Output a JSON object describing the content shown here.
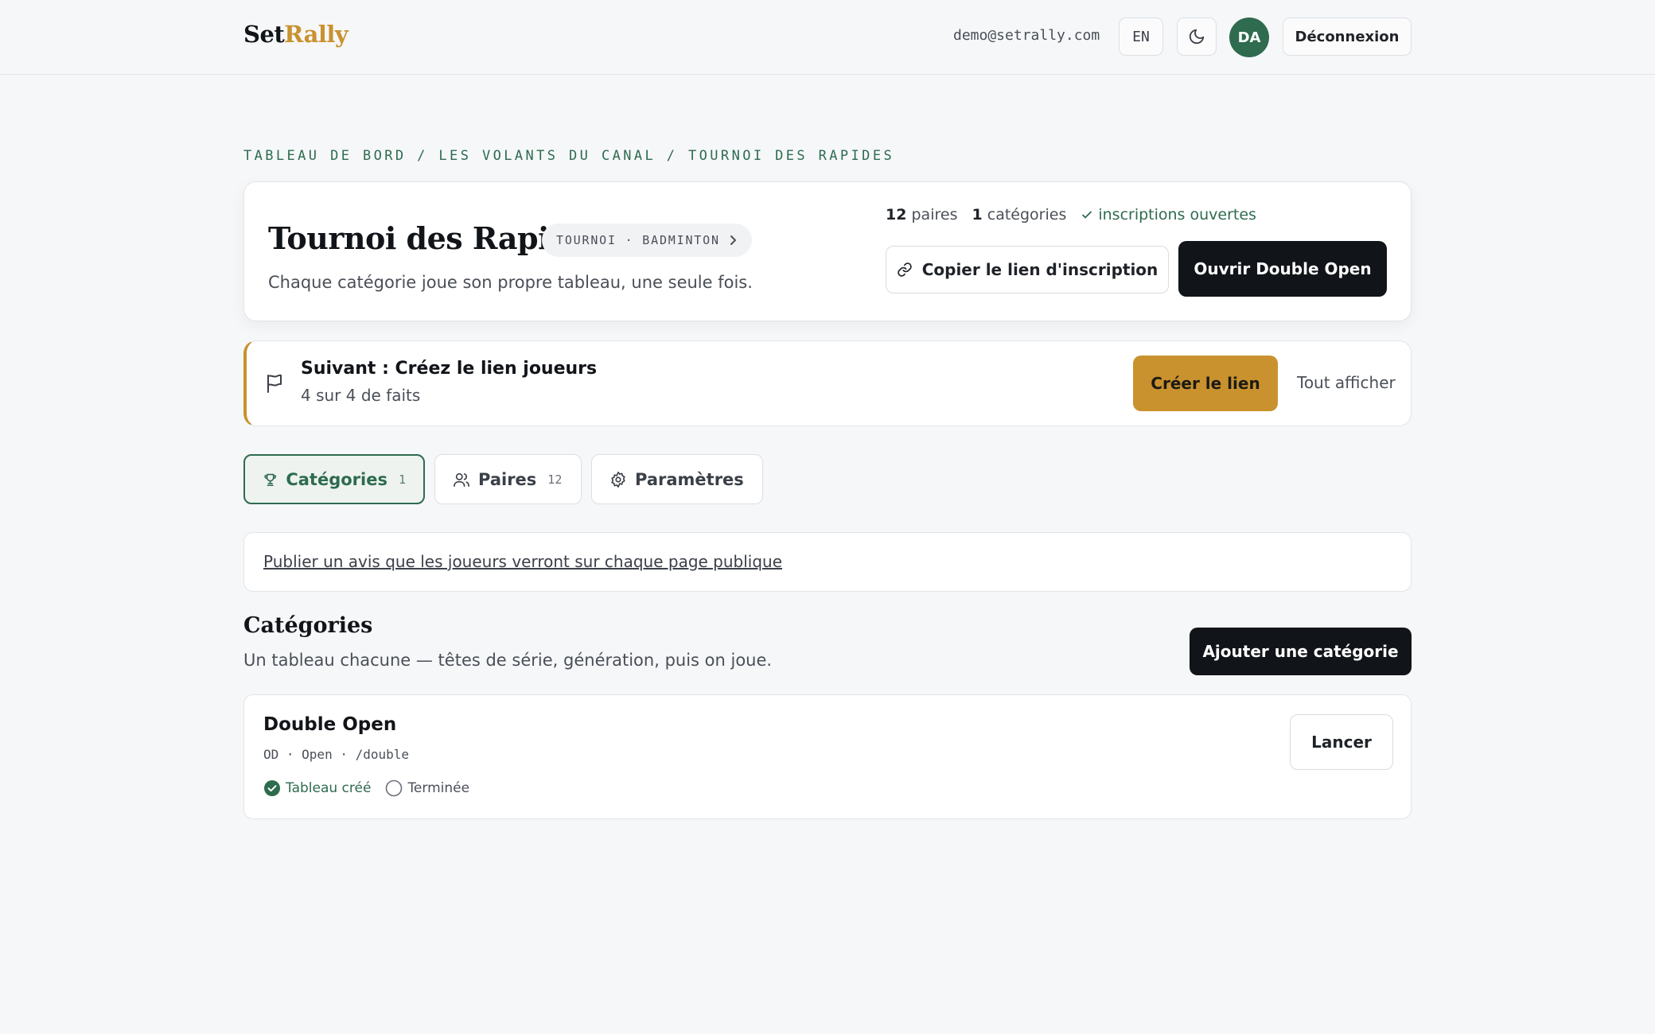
{
  "nav": {
    "logo_part1": "Set",
    "logo_part2": "Rally",
    "email": "demo@setrally.com",
    "lang": "EN",
    "avatar": "DA",
    "logout": "Déconnexion"
  },
  "breadcrumb": "TABLEAU DE BORD / LES VOLANTS DU CANAL / TOURNOI DES RAPIDES",
  "tournament": {
    "title": "Tournoi des Rapides",
    "pill": "TOURNOI · BADMINTON",
    "subtitle": "Chaque catégorie joue son propre tableau, une seule fois.",
    "pairs_count": "12",
    "pairs_label": "paires",
    "categories_count": "1",
    "categories_label": "catégories",
    "registration_status": "inscriptions ouvertes",
    "copy_link": "Copier le lien d'inscription",
    "open_button": "Ouvrir Double Open"
  },
  "next_step": {
    "title": "Suivant : Créez le lien joueurs",
    "progress": "4 sur 4 de faits",
    "action": "Créer le lien",
    "show_all": "Tout afficher"
  },
  "tabs": [
    {
      "label": "Catégories",
      "count": "1"
    },
    {
      "label": "Paires",
      "count": "12"
    },
    {
      "label": "Paramètres",
      "count": ""
    }
  ],
  "notice_link": "Publier un avis que les joueurs verront sur chaque page publique",
  "section": {
    "title": "Catégories",
    "subtitle": "Un tableau chacune — têtes de série, génération, puis on joue.",
    "add_button": "Ajouter une catégorie"
  },
  "category": {
    "name": "Double Open",
    "meta": "OD · Open · /double",
    "step_done": "Tableau créé",
    "step_todo": "Terminée",
    "launch": "Lancer"
  },
  "colors": {
    "accent_green": "#2e6b4f",
    "accent_gold": "#c9922e",
    "dark": "#111418"
  }
}
